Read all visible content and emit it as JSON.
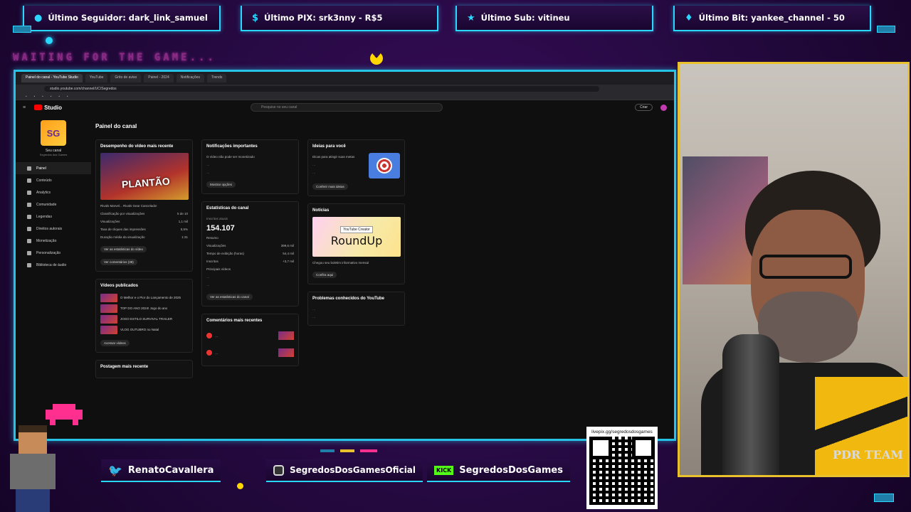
{
  "alerts": [
    {
      "label": "Último Seguidor: dark_link_samuel",
      "icon": "user-icon"
    },
    {
      "label": "Último PIX: srk3nny - R$5",
      "icon": "dollar-icon"
    },
    {
      "label": "Último Sub: vitineu",
      "icon": "star-icon"
    },
    {
      "label": "Último Bit: yankee_channel - 50",
      "icon": "diamond-icon"
    }
  ],
  "waiting_text": "WAITING FOR THE GAME...",
  "browser": {
    "tabs": [
      "Painel do canal - YouTube Studio",
      "YouTube",
      "Grito de aviso",
      "Painel - 2024",
      "Notificações",
      "Trends"
    ],
    "address": "studio.youtube.com/channel/UC/Segredos"
  },
  "yt": {
    "logo": "Studio",
    "search_placeholder": "Pesquise no seu canal",
    "create_label": "Criar",
    "channel_name": "Seu canal",
    "channel_sub": "Segredos dos Games",
    "nav": [
      "Painel",
      "Conteúdo",
      "Analytics",
      "Comunidade",
      "Legendas",
      "Direitos autorais",
      "Monetização",
      "Personalização",
      "Biblioteca de áudio"
    ],
    "page_title": "Painel do canal",
    "col1": {
      "perf_title": "Desempenho do vídeo mais recente",
      "thumb_text": "PLANTÃO",
      "video_title": "Rivals Marvel... Rivals Gear Cancelado!",
      "stats": [
        {
          "k": "Classificação por visualizações",
          "v": "5 de 10"
        },
        {
          "k": "Visualizações",
          "v": "1,1 mil"
        },
        {
          "k": "Taxa de cliques das impressões",
          "v": "5,5%"
        },
        {
          "k": "Duração média da visualização",
          "v": "1:31"
        }
      ],
      "btn_analytics": "Ver as estatísticas do vídeo",
      "btn_comments": "Ver comentários (38)",
      "published_title": "Vídeos publicados",
      "published": [
        "O Melhor e o Pior do Lançamento de 2025",
        "TOP DO ANO 2024! Jogo do ano",
        "JOGO ESTILO SURVIVAL TRAILER",
        "VLOG OUTUBRO no Natal"
      ],
      "btn_all_videos": "Acessar vídeos",
      "posts_title": "Postagem mais recente"
    },
    "col2": {
      "notif_title": "Notificações importantes",
      "notif_text": "O vídeo não pode ser monetizado",
      "btn_check": "Mostrar opções",
      "stats_title": "Estatísticas do canal",
      "subs_label": "Inscritos atuais",
      "subs_value": "154.107",
      "summary_title": "Resumo",
      "summary": [
        {
          "k": "Visualizações",
          "v": "399,6 mil"
        },
        {
          "k": "Tempo de exibição (horas)",
          "v": "54,4 mil"
        },
        {
          "k": "Inscritos",
          "v": "+3,7 mil"
        }
      ],
      "top_videos_title": "Principais vídeos",
      "btn_channel_stats": "Ver as estatísticas do canal",
      "comments_title": "Comentários mais recentes"
    },
    "col3": {
      "ideas_title": "Ideias para você",
      "ideas_sub": "Dicas para atingir suas metas",
      "btn_ideas": "Conferir mais ideias",
      "news_title": "Notícias",
      "roundup_tag": "YouTube Creator",
      "roundup_title": "RoundUp",
      "news_caption": "Chegou seu boletim informativo mensal",
      "btn_news": "Confira aqui",
      "problems_title": "Problemas conhecidos do YouTube"
    }
  },
  "social": {
    "twitter": "RenatoCavallera",
    "instagram": "SegredosDosGamesOficial",
    "kick_label": "KICK",
    "kick": "SegredosDosGames",
    "qr_url": "livepix.gg/segredosdosgames"
  },
  "cam_badge": "PDR TEAM"
}
